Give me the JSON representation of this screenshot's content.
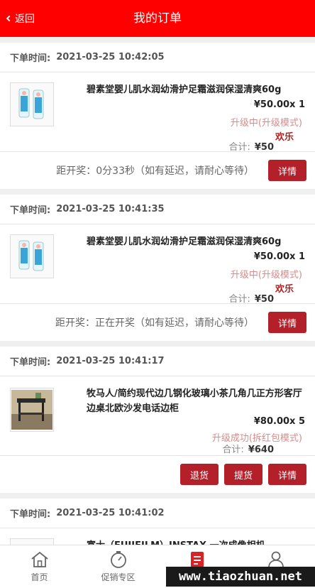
{
  "header": {
    "back_label": "返回",
    "title": "我的订单"
  },
  "order_time_label": "下单时间:",
  "total_label": "合计:",
  "orders": [
    {
      "time": "2021-03-25 10:42:05",
      "item_name": "碧素堂婴儿肌水润幼滑护足霜滋润保湿清爽60g",
      "price": "¥50.00x 1",
      "status": "升级中(升级模式)",
      "nickname": "欢乐",
      "total": "¥50",
      "countdown": "距开奖：0分33秒（如有延迟，请耐心等待）",
      "actions": [
        "详情"
      ]
    },
    {
      "time": "2021-03-25 10:41:35",
      "item_name": "碧素堂婴儿肌水润幼滑护足霜滋润保湿清爽60g",
      "price": "¥50.00x 1",
      "status": "升级中(升级模式)",
      "nickname": "欢乐",
      "total": "¥50",
      "countdown": "距开奖：正在开奖（如有延迟，请耐心等待）",
      "actions": [
        "详情"
      ]
    },
    {
      "time": "2021-03-25 10:41:17",
      "item_name": "牧马人/简约现代边几钢化玻璃小茶几角几正方形客厅边桌北欧沙发电话边柜",
      "price": "¥80.00x 5",
      "status": "升级成功(拆红包模式)",
      "total": "¥640",
      "actions": [
        "退货",
        "提货",
        "详情"
      ]
    },
    {
      "time": "2021-03-25 10:41:02",
      "item_name": "富士（FUJIFILM）INSTAX 一次成像相机"
    }
  ],
  "tabbar": [
    {
      "label": "首页",
      "icon": "home-icon"
    },
    {
      "label": "促销专区",
      "icon": "timer-icon"
    },
    {
      "label": "",
      "icon": "orders-icon"
    },
    {
      "label": "",
      "icon": "user-icon"
    }
  ],
  "watermark": "www.tiaozhuan.net",
  "colors": {
    "header": "#fe0000",
    "button": "#b3202a",
    "status": "#d88c8c",
    "nickname": "#b02020",
    "tab_active": "#e02020"
  }
}
